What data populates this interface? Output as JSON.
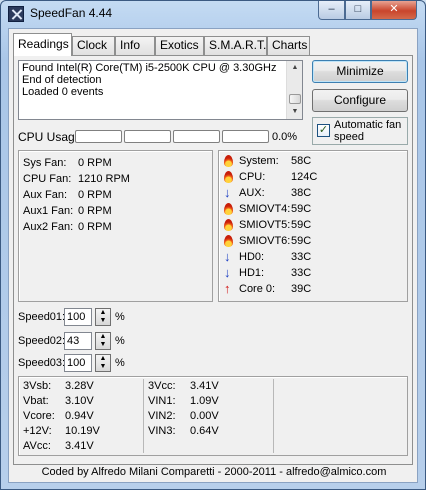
{
  "window": {
    "title": "SpeedFan 4.44"
  },
  "caption_buttons": {
    "minimize": "–",
    "maximize": "□",
    "close": "✕"
  },
  "tabs": [
    {
      "label": "Readings",
      "active": true
    },
    {
      "label": "Clock",
      "active": false
    },
    {
      "label": "Info",
      "active": false
    },
    {
      "label": "Exotics",
      "active": false
    },
    {
      "label": "S.M.A.R.T.",
      "active": false
    },
    {
      "label": "Charts",
      "active": false
    }
  ],
  "log": {
    "lines": [
      "Found Intel(R) Core(TM) i5-2500K CPU @ 3.30GHz",
      "End of detection",
      "Loaded 0 events"
    ]
  },
  "buttons": {
    "minimize": "Minimize",
    "configure": "Configure"
  },
  "auto_fan": {
    "label": "Automatic fan speed",
    "checked": true,
    "check_glyph": "✓"
  },
  "cpu_usage": {
    "label": "CPU Usage",
    "bars": [
      0,
      0,
      0,
      0
    ],
    "percent": "0.0%"
  },
  "fans": [
    {
      "label": "Sys Fan:",
      "value": "0 RPM"
    },
    {
      "label": "CPU Fan:",
      "value": "1210 RPM"
    },
    {
      "label": "Aux Fan:",
      "value": "0 RPM"
    },
    {
      "label": "Aux1 Fan:",
      "value": "0 RPM"
    },
    {
      "label": "Aux2 Fan:",
      "value": "0 RPM"
    }
  ],
  "temps": [
    {
      "icon": "flame-icon",
      "label": "System:",
      "value": "58C"
    },
    {
      "icon": "flame-icon",
      "label": "CPU:",
      "value": "124C"
    },
    {
      "icon": "arrow-down-icon",
      "label": "AUX:",
      "value": "38C"
    },
    {
      "icon": "flame-icon",
      "label": "SMIOVT4:",
      "value": "59C"
    },
    {
      "icon": "flame-icon",
      "label": "SMIOVT5:",
      "value": "59C"
    },
    {
      "icon": "flame-icon",
      "label": "SMIOVT6:",
      "value": "59C"
    },
    {
      "icon": "arrow-down-icon",
      "label": "HD0:",
      "value": "33C"
    },
    {
      "icon": "arrow-down-icon",
      "label": "HD1:",
      "value": "33C"
    },
    {
      "icon": "arrow-up-icon",
      "label": "Core 0:",
      "value": "39C"
    }
  ],
  "speeds": [
    {
      "label": "Speed01:",
      "value": "100",
      "unit": "%"
    },
    {
      "label": "Speed02:",
      "value": "43",
      "unit": "%"
    },
    {
      "label": "Speed03:",
      "value": "100",
      "unit": "%"
    }
  ],
  "voltages_left": [
    {
      "label": "3Vsb:",
      "value": "3.28V"
    },
    {
      "label": "Vbat:",
      "value": "3.10V"
    },
    {
      "label": "Vcore:",
      "value": "0.94V"
    },
    {
      "label": "+12V:",
      "value": "10.19V"
    },
    {
      "label": "AVcc:",
      "value": "3.41V"
    }
  ],
  "voltages_right": [
    {
      "label": "3Vcc:",
      "value": "3.41V"
    },
    {
      "label": "VIN1:",
      "value": "1.09V"
    },
    {
      "label": "VIN2:",
      "value": "0.00V"
    },
    {
      "label": "VIN3:",
      "value": "0.64V"
    }
  ],
  "footer": "Coded by Alfredo Milani Comparetti - 2000-2011 - alfredo@almico.com",
  "colors": {
    "flame": "#e4401a",
    "arrow_down": "#1d3fc4",
    "arrow_up": "#d21a1a",
    "title_bar": "#b7cfeb"
  }
}
